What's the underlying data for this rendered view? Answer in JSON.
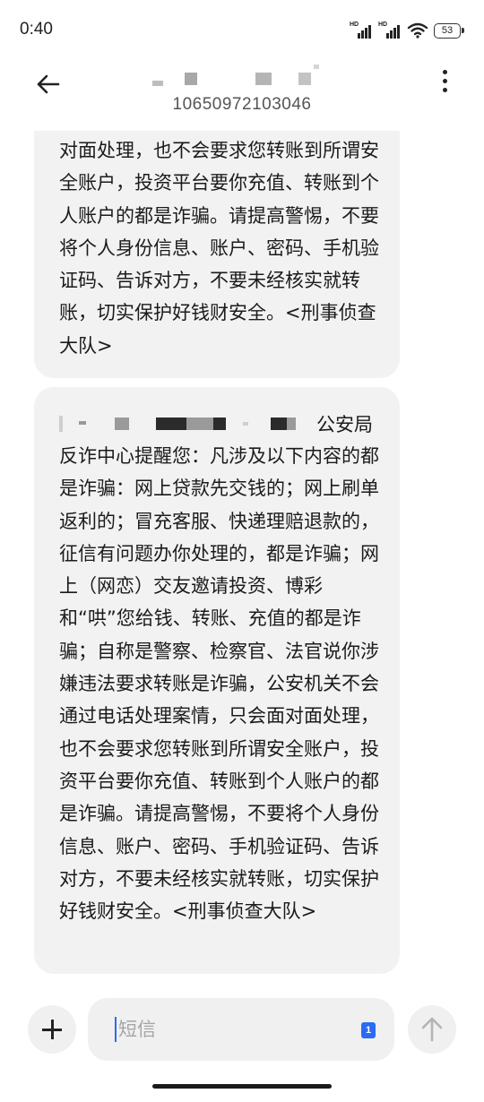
{
  "status_bar": {
    "time": "0:40",
    "battery_level": "53",
    "sim1_label": "HD",
    "sim2_label": "HD"
  },
  "header": {
    "contact_number": "10650972103046"
  },
  "messages": [
    {
      "text": "对面处理，也不会要求您转账到所谓安全账户，投资平台要你充值、转账到个人账户的都是诈骗。请提高警惕，不要将个人身份信息、账户、密码、手机验证码、告诉对方，不要未经核实就转账，切实保护好钱财安全。<刑事侦查大队>"
    },
    {
      "redacted_prefix_tail": "公安局",
      "text": "反诈中心提醒您：凡涉及以下内容的都是诈骗：网上贷款先交钱的；网上刷单返利的；冒充客服、快递理赔退款的，征信有问题办你处理的，都是诈骗；网上（网恋）交友邀请投资、博彩和“哄”您给钱、转账、充值的都是诈骗；自称是警察、检察官、法官说你涉嫌违法要求转账是诈骗，公安机关不会通过电话处理案情，只会面对面处理，也不会要求您转账到所谓安全账户，投资平台要你充值、转账到个人账户的都是诈骗。请提高警惕，不要将个人身份信息、账户、密码、手机验证码、告诉对方，不要未经核实就转账，切实保护好钱财安全。<刑事侦查大队>"
    }
  ],
  "composer": {
    "placeholder": "短信",
    "sim_badge": "1"
  },
  "icons": {
    "back": "back-arrow-icon",
    "more": "more-vertical-icon",
    "add": "plus-icon",
    "send": "send-arrow-icon"
  }
}
